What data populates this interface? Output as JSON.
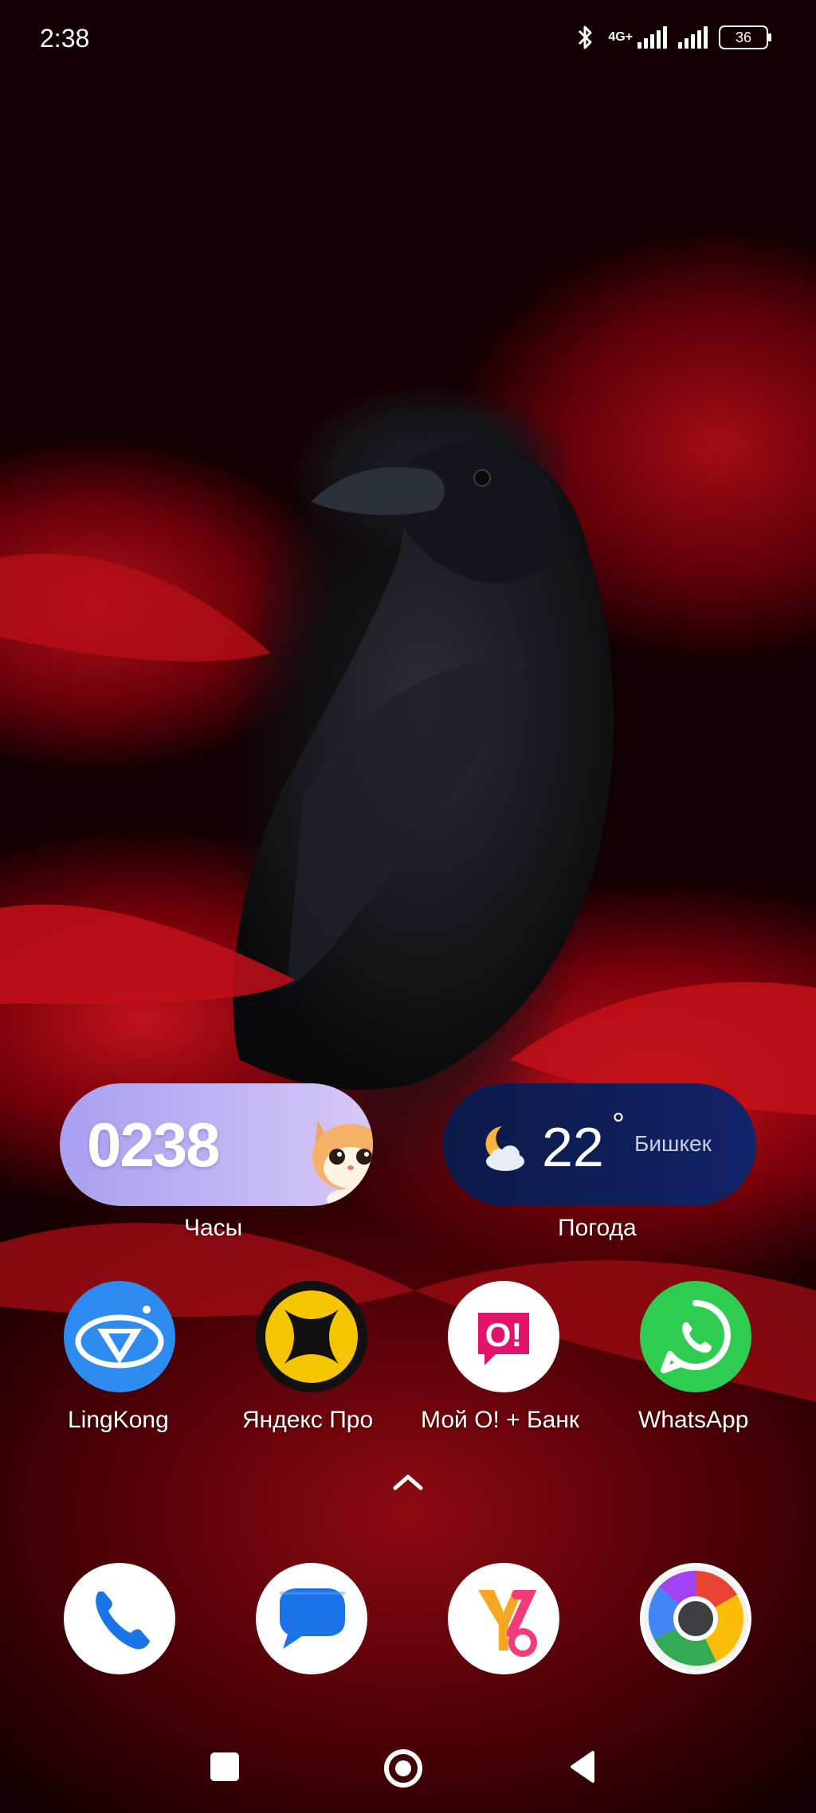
{
  "status_bar": {
    "time": "2:38",
    "network": "4G+",
    "battery": "36"
  },
  "widgets": {
    "clock": {
      "digits": "0238",
      "label": "Часы"
    },
    "weather": {
      "temperature": "22",
      "degree": "°",
      "city": "Бишкек",
      "label": "Погода"
    }
  },
  "apps": [
    {
      "label": "LingKong",
      "icon": "lingkong-icon"
    },
    {
      "label": "Яндекс Про",
      "icon": "yandex-pro-icon"
    },
    {
      "label": "Мой О! + Банк",
      "icon": "moy-o-icon"
    },
    {
      "label": "WhatsApp",
      "icon": "whatsapp-icon"
    }
  ],
  "dock": [
    {
      "icon": "phone-icon"
    },
    {
      "icon": "messages-icon"
    },
    {
      "icon": "yandex-icon"
    },
    {
      "icon": "chrome-icon"
    }
  ],
  "colors": {
    "whatsapp": "#2fcc52",
    "lingkong": "#2e8cf0",
    "yandex_pro": "#f5c500",
    "moy_o": "#e3136b"
  }
}
